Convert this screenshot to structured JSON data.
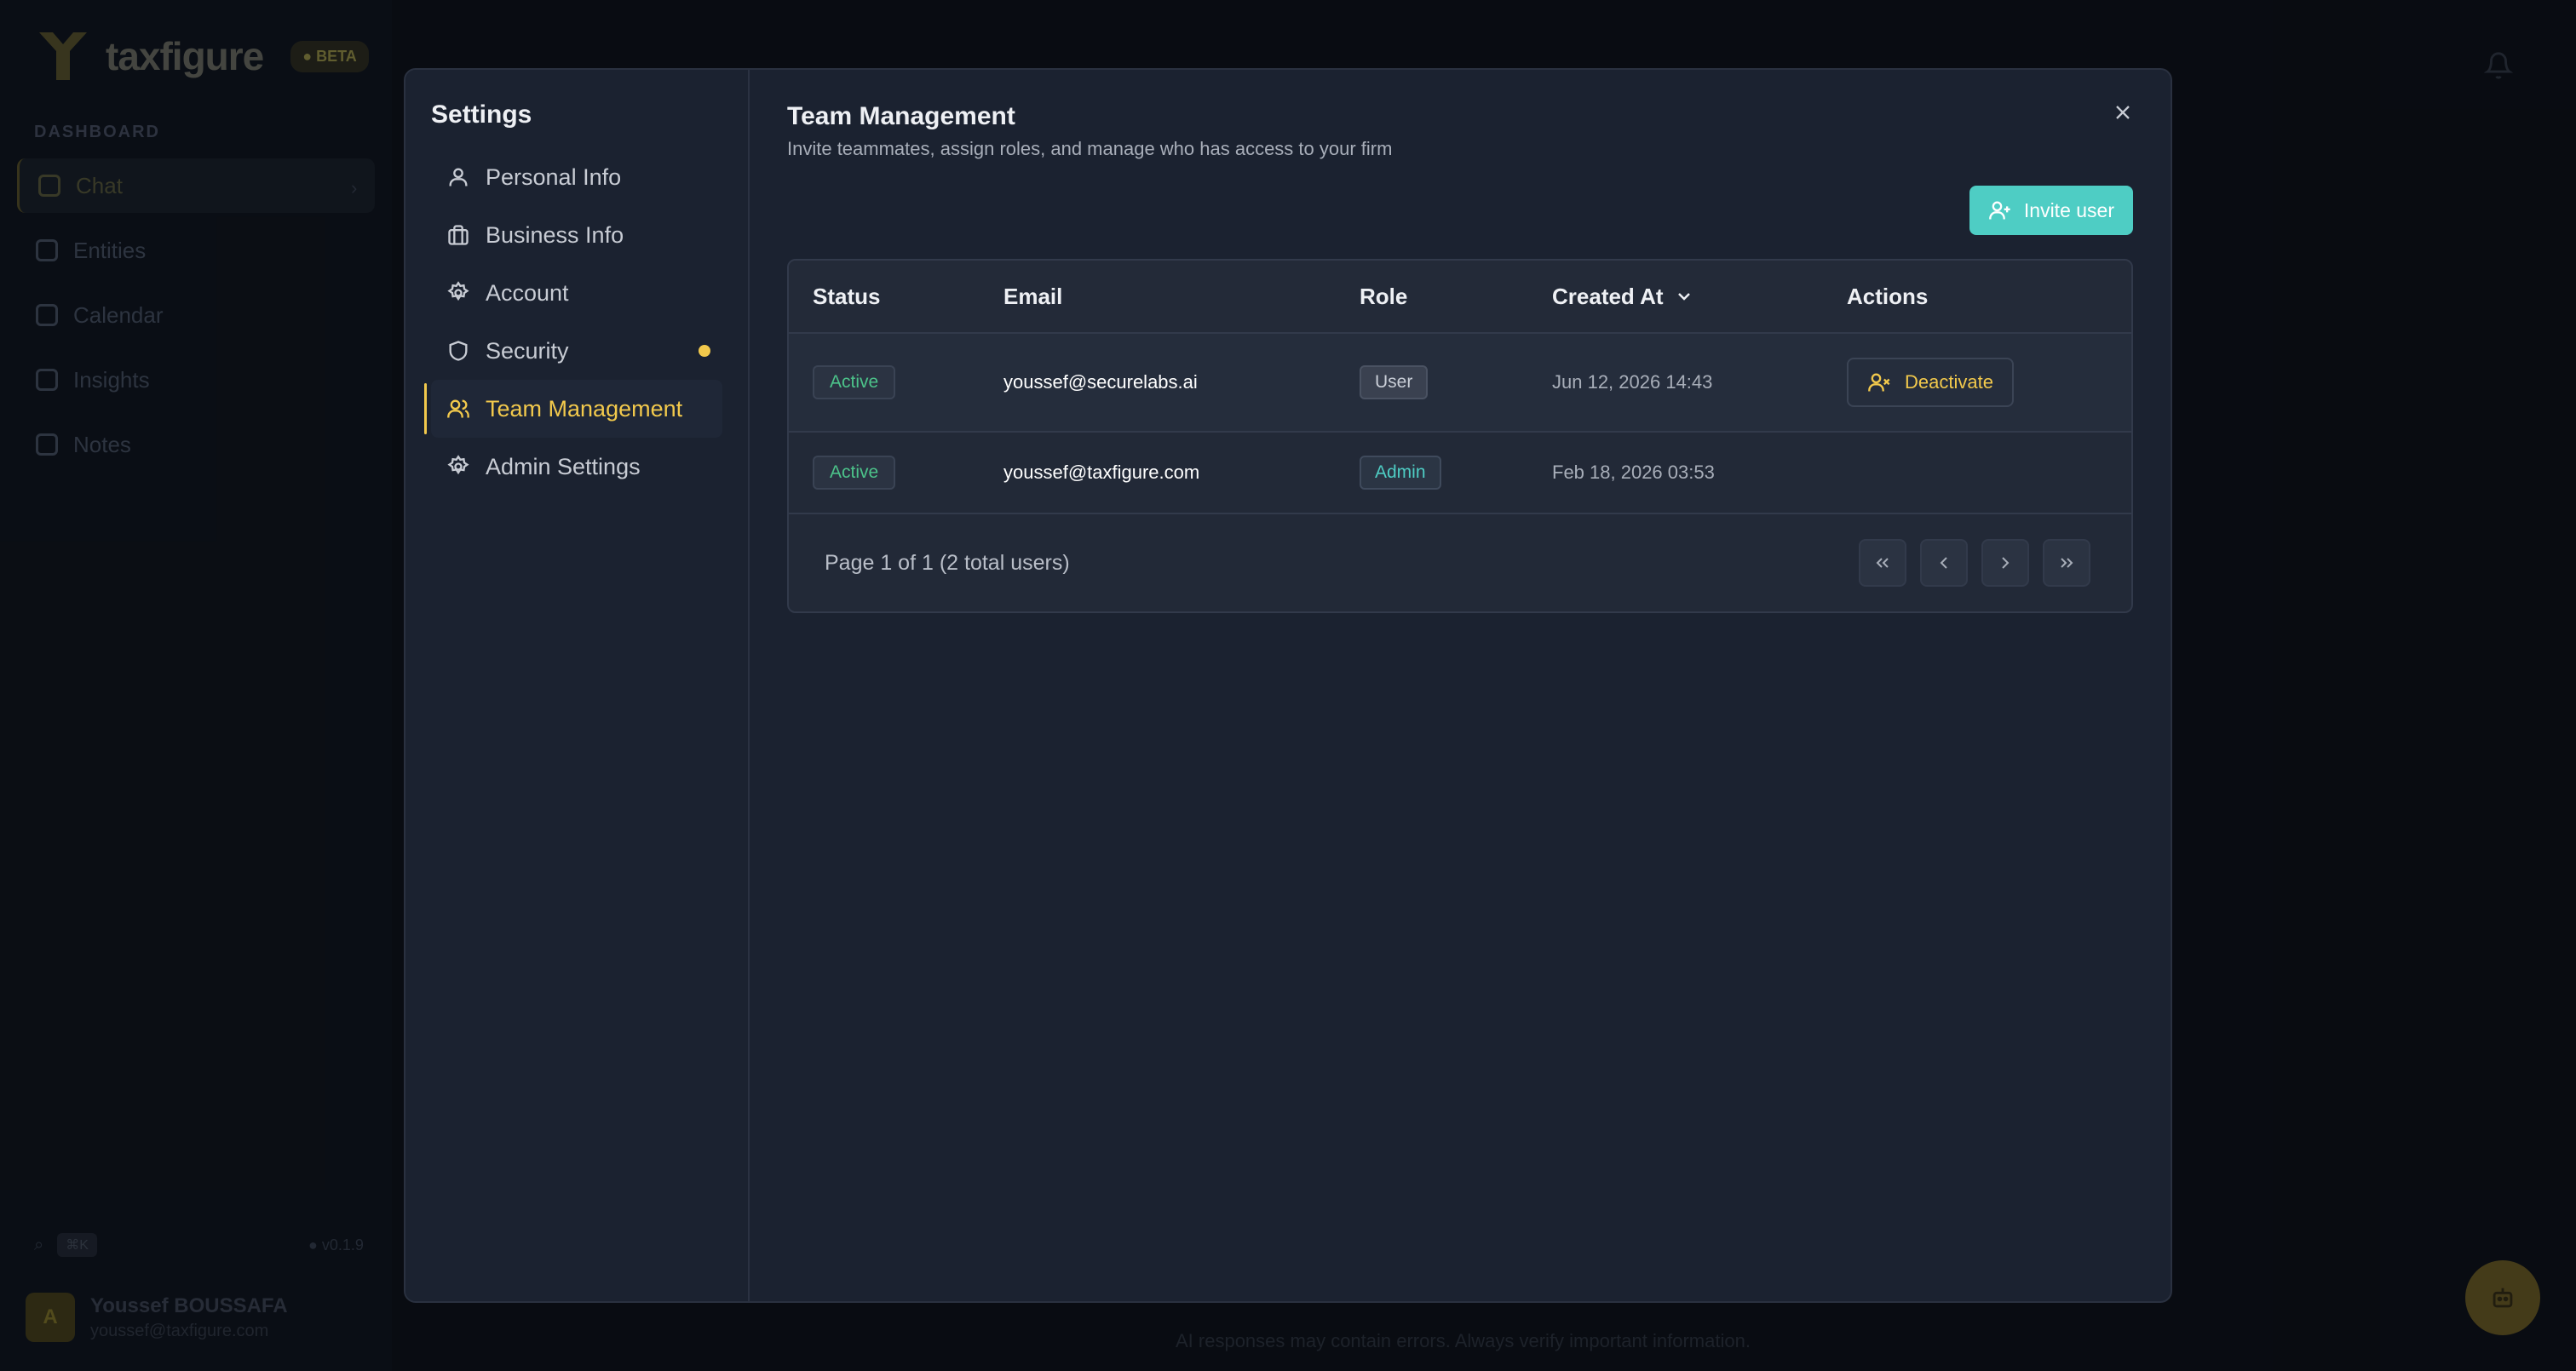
{
  "background": {
    "logo_text": "taxfigure",
    "beta_badge": "● BETA",
    "section_label": "DASHBOARD",
    "nav": [
      "Chat",
      "Entities",
      "Calendar",
      "Insights",
      "Notes"
    ],
    "search_shortcut": "⌘K",
    "version": "● v0.1.9",
    "user": {
      "initial": "A",
      "name": "Youssef BOUSSAFA",
      "email": "youssef@taxfigure.com"
    },
    "disclaimer": "AI responses may contain errors. Always verify important information."
  },
  "settings": {
    "title": "Settings",
    "nav": [
      {
        "label": "Personal Info",
        "icon": "user-icon"
      },
      {
        "label": "Business Info",
        "icon": "briefcase-icon"
      },
      {
        "label": "Account",
        "icon": "gear-icon"
      },
      {
        "label": "Security",
        "icon": "shield-icon"
      },
      {
        "label": "Team Management",
        "icon": "users-icon"
      },
      {
        "label": "Admin Settings",
        "icon": "gear-icon"
      }
    ],
    "active_item": "Team Management"
  },
  "team": {
    "title": "Team Management",
    "subtitle": "Invite teammates, assign roles, and manage who has access to your firm",
    "invite_label": "Invite user",
    "columns": [
      "Status",
      "Email",
      "Role",
      "Created At",
      "Actions"
    ],
    "rows": [
      {
        "status": "Active",
        "email": "youssef@securelabs.ai",
        "role": "User",
        "created": "Jun 12, 2026 14:43",
        "action": "Deactivate"
      },
      {
        "status": "Active",
        "email": "youssef@taxfigure.com",
        "role": "Admin",
        "created": "Feb 18, 2026 03:53",
        "action": ""
      }
    ],
    "page_info": "Page 1 of 1 (2 total users)"
  },
  "colors": {
    "accent_yellow": "#f2c94c",
    "accent_teal": "#4ecdc4",
    "status_green": "#4cc38a",
    "modal_bg": "#1b2230"
  }
}
